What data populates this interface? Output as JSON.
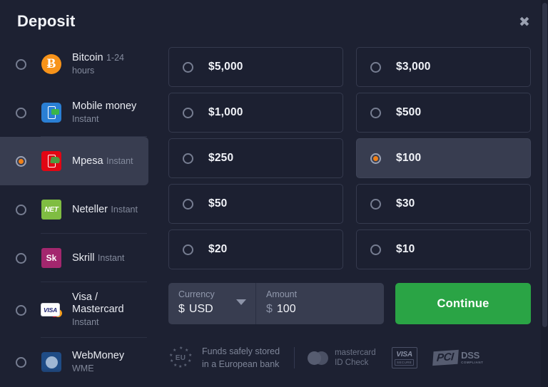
{
  "dialog": {
    "title": "Deposit",
    "close_icon": "close-icon"
  },
  "sidebar": {
    "methods": [
      {
        "name": "Bitcoin",
        "sub": "1-24 hours",
        "icon": "bitcoin-icon",
        "selected": false
      },
      {
        "name": "Mobile money",
        "sub": "Instant",
        "icon": "mobile-money-icon",
        "selected": false
      },
      {
        "name": "Mpesa",
        "sub": "Instant",
        "icon": "mpesa-icon",
        "selected": true
      },
      {
        "name": "Neteller",
        "sub": "Instant",
        "icon": "neteller-icon",
        "selected": false
      },
      {
        "name": "Skrill",
        "sub": "Instant",
        "icon": "skrill-icon",
        "selected": false
      },
      {
        "name": "Visa / Mastercard",
        "sub": "Instant",
        "icon": "visa-mastercard-icon",
        "selected": false
      },
      {
        "name": "WebMoney",
        "sub": "WME",
        "icon": "webmoney-icon",
        "selected": false
      }
    ],
    "icon_labels": {
      "bitcoin": "Ƀ",
      "neteller": "NET",
      "skrill": "Sk",
      "visa": "VISA"
    }
  },
  "amounts": [
    {
      "label": "$5,000",
      "selected": false
    },
    {
      "label": "$3,000",
      "selected": false
    },
    {
      "label": "$1,000",
      "selected": false
    },
    {
      "label": "$500",
      "selected": false
    },
    {
      "label": "$250",
      "selected": false
    },
    {
      "label": "$100",
      "selected": true
    },
    {
      "label": "$50",
      "selected": false
    },
    {
      "label": "$30",
      "selected": false
    },
    {
      "label": "$20",
      "selected": false
    },
    {
      "label": "$10",
      "selected": false
    }
  ],
  "form": {
    "currency": {
      "label": "Currency",
      "symbol": "$",
      "value": "USD",
      "caret_icon": "chevron-down-icon"
    },
    "amount": {
      "label": "Amount",
      "symbol": "$",
      "value": "100",
      "placeholder": "Amount"
    },
    "continue_label": "Continue"
  },
  "footer": {
    "eu_badge_text": "EU",
    "safety_note_line1": "Funds safely stored",
    "safety_note_line2": "in a European bank",
    "mastercard_line1": "mastercard",
    "mastercard_line2": "ID Check",
    "visa_line1": "VISA",
    "visa_line2": "SECURE",
    "pci_mark": "PCI",
    "pci_title": "DSS",
    "pci_sub": "COMPLIANT"
  },
  "colors": {
    "background": "#1d2132",
    "selected_row": "#383d50",
    "accent_orange": "#f08018",
    "continue_green": "#2aa445",
    "bitcoin_orange": "#f7931a",
    "mpesa_red": "#e20613",
    "neteller_green": "#7fbd42",
    "skrill_magenta": "#a3276e",
    "mobile_blue": "#2a7fd4"
  }
}
